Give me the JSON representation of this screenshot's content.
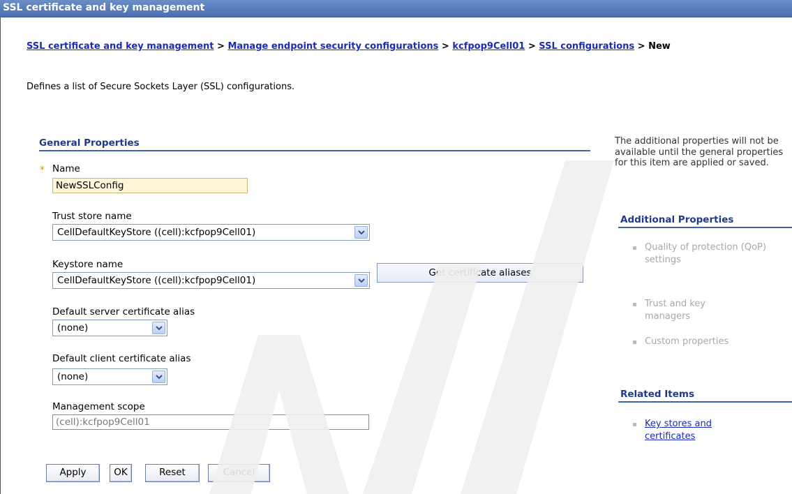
{
  "window": {
    "title": "SSL certificate and key management"
  },
  "breadcrumb": {
    "items": [
      "SSL certificate and key management",
      "Manage endpoint security configurations",
      "kcfpop9Cell01",
      "SSL configurations"
    ],
    "separator": ">",
    "current": "New"
  },
  "description": "Defines a list of Secure Sockets Layer (SSL) configurations.",
  "general": {
    "title": "General Properties",
    "required_marker": "*",
    "name_label": "Name",
    "name_value": "NewSSLConfig",
    "trust_store_label": "Trust store name",
    "trust_store_value": "CellDefaultKeyStore ((cell):kcfpop9Cell01)",
    "keystore_label": "Keystore name",
    "keystore_value": "CellDefaultKeyStore ((cell):kcfpop9Cell01)",
    "get_aliases_label": "Get certificate aliases",
    "server_alias_label": "Default server certificate alias",
    "server_alias_value": "(none)",
    "client_alias_label": "Default client certificate alias",
    "client_alias_value": "(none)",
    "scope_label": "Management scope",
    "scope_value": "(cell):kcfpop9Cell01"
  },
  "buttons": {
    "apply": "Apply",
    "ok": "OK",
    "reset": "Reset",
    "cancel": "Cancel"
  },
  "sidebar": {
    "note": "The additional properties will not be available until the general properties for this item are applied or saved.",
    "additional_title": "Additional Properties",
    "additional_items": [
      "Quality of protection (QoP) settings",
      "Trust and key managers",
      "Custom properties"
    ],
    "related_title": "Related Items",
    "related_items": [
      "Key stores and certificates"
    ]
  },
  "colors": {
    "accent": "#3c63a8",
    "link": "#1a2bb8",
    "titlebar": "#4a6fb0",
    "required_field": "#fff6d8"
  },
  "icons": {
    "dropdown": "chevron-down-icon",
    "required": "required-star-icon",
    "bullet": "bullet-icon"
  }
}
